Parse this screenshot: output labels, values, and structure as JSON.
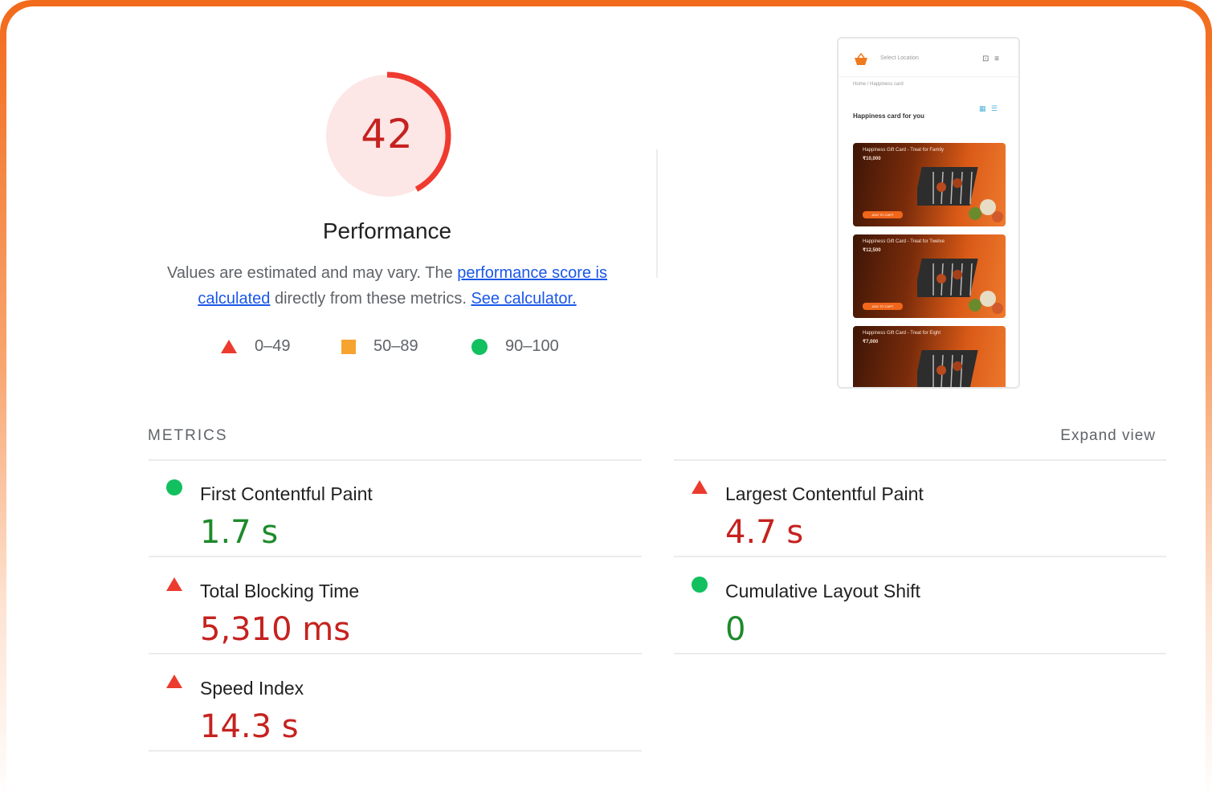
{
  "gauge": {
    "score": "42",
    "score_fraction": 0.42,
    "title": "Performance",
    "ring_color": "#ef3a2f",
    "bg_color": "#fde6e6"
  },
  "description": {
    "text1": "Values are estimated and may vary. The ",
    "link1": "performance score is calculated",
    "text2": " directly from these metrics. ",
    "link2": "See calculator."
  },
  "legend": [
    {
      "shape": "triangle",
      "label": "0–49",
      "color": "#eb3b2f"
    },
    {
      "shape": "square",
      "label": "50–89",
      "color": "#f6a42f"
    },
    {
      "shape": "circle",
      "label": "90–100",
      "color": "#12c05f"
    }
  ],
  "screenshot": {
    "location": "Select Location",
    "breadcrumb": "Home / Happiness card",
    "title": "Happiness card for you",
    "cards": [
      {
        "title": "Happiness Gift Card - Treat for Family",
        "price": "₹10,000",
        "button": "ADD TO CART"
      },
      {
        "title": "Happiness Gift Card - Treat for Twelve",
        "price": "₹12,500",
        "button": "ADD TO CART"
      },
      {
        "title": "Happiness Gift Card - Treat for Eight",
        "price": "₹7,000",
        "button": "ADD TO CART"
      }
    ]
  },
  "metrics": {
    "section_label": "METRICS",
    "expand_label": "Expand view",
    "items": [
      {
        "name": "First Contentful Paint",
        "value": "1.7 s",
        "status": "good"
      },
      {
        "name": "Largest Contentful Paint",
        "value": "4.7 s",
        "status": "bad"
      },
      {
        "name": "Total Blocking Time",
        "value": "5,310 ms",
        "status": "bad"
      },
      {
        "name": "Cumulative Layout Shift",
        "value": "0",
        "status": "good"
      },
      {
        "name": "Speed Index",
        "value": "14.3 s",
        "status": "bad"
      }
    ]
  },
  "colors": {
    "frame_accent": "#f26a1b",
    "link": "#1a57e8",
    "good": "#1e8a2b",
    "bad": "#c5221f"
  }
}
